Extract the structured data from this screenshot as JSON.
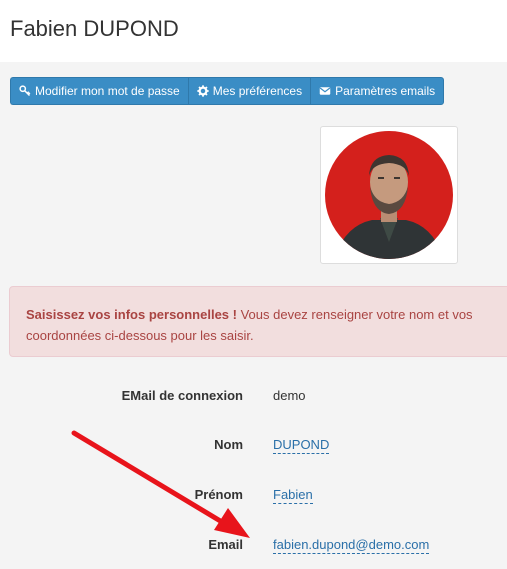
{
  "page": {
    "title": "Fabien DUPOND"
  },
  "toolbar": {
    "buttons": [
      {
        "label": "Modifier mon mot de passe",
        "icon": "key-icon"
      },
      {
        "label": "Mes préférences",
        "icon": "gear-icon"
      },
      {
        "label": "Paramètres emails",
        "icon": "envelope-icon"
      }
    ]
  },
  "alert": {
    "strong": "Saisissez vos infos personnelles !",
    "text": " Vous devez renseigner votre nom et vos coordonnées ci-dessous pour les saisir."
  },
  "profile": {
    "fields": [
      {
        "label": "EMail de connexion",
        "value": "demo"
      },
      {
        "label": "Nom",
        "value": "DUPOND"
      },
      {
        "label": "Prénom",
        "value": "Fabien"
      },
      {
        "label": "Email",
        "value": "fabien.dupond@demo.com"
      }
    ]
  },
  "colors": {
    "button": "#3a8dc5",
    "alert_bg": "#f2dede",
    "alert_text": "#a94442",
    "link": "#2a6fa8",
    "arrow": "#e8141b"
  }
}
